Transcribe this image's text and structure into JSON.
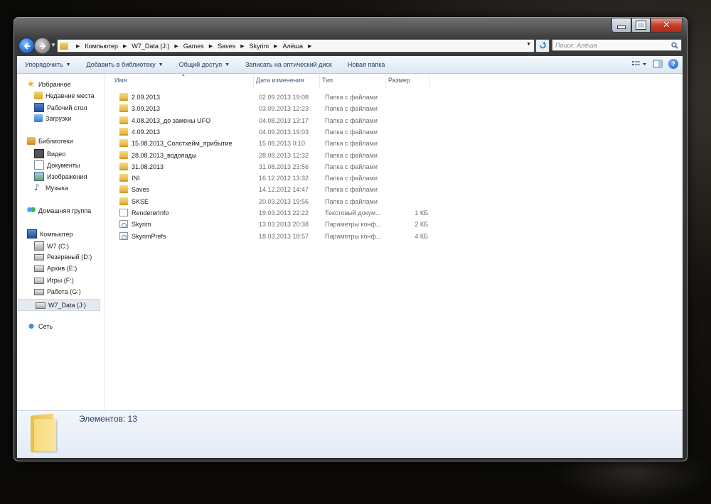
{
  "window": {
    "address": [
      "Компьютер",
      "W7_Data (J:)",
      "Games",
      "Saves",
      "Skyrim",
      "Алёша"
    ],
    "search_placeholder": "Поиск: Алёша"
  },
  "toolbar": {
    "organize": "Упорядочить",
    "add_to_library": "Добавить в библиотеку",
    "share": "Общий доступ",
    "burn": "Записать на оптический диск",
    "new_folder": "Новая папка"
  },
  "navigation": {
    "favorites": {
      "label": "Избранное",
      "items": [
        "Недавние места",
        "Рабочий стол",
        "Загрузки"
      ]
    },
    "libraries": {
      "label": "Библиотеки",
      "items": [
        "Видео",
        "Документы",
        "Изображения",
        "Музыка"
      ]
    },
    "homegroup": {
      "label": "Домашняя группа"
    },
    "computer": {
      "label": "Компьютер",
      "items": [
        "W7 (C:)",
        "Резервный (D:)",
        "Архив (E:)",
        "Игры (F:)",
        "Работа (G:)",
        "W7_Data (J:)"
      ],
      "selected": "W7_Data (J:)"
    },
    "network": {
      "label": "Сеть"
    }
  },
  "columns": {
    "name": "Имя",
    "date": "Дата изменения",
    "type": "Тип",
    "size": "Размер"
  },
  "files": [
    {
      "icon": "folder-icon",
      "name": "2.09.2013",
      "date": "02.09.2013 19:08",
      "type": "Папка с файлами",
      "size": ""
    },
    {
      "icon": "folder-icon",
      "name": "3.09.2013",
      "date": "03.09.2013 12:23",
      "type": "Папка с файлами",
      "size": ""
    },
    {
      "icon": "folder-icon",
      "name": "4.08.2013_до замены UFO",
      "date": "04.08.2013 13:17",
      "type": "Папка с файлами",
      "size": ""
    },
    {
      "icon": "folder-icon",
      "name": "4.09.2013",
      "date": "04.09.2013 19:03",
      "type": "Папка с файлами",
      "size": ""
    },
    {
      "icon": "folder-icon",
      "name": "15.08.2013_Солстхейм_прибытие",
      "date": "15.08.2013 0:10",
      "type": "Папка с файлами",
      "size": ""
    },
    {
      "icon": "folder-icon",
      "name": "28.08.2013_водопады",
      "date": "28.08.2013 12:32",
      "type": "Папка с файлами",
      "size": ""
    },
    {
      "icon": "folder-icon",
      "name": "31.08.2013",
      "date": "31.08.2013 23:56",
      "type": "Папка с файлами",
      "size": ""
    },
    {
      "icon": "folder-icon",
      "name": "INI",
      "date": "16.12.2012 13:32",
      "type": "Папка с файлами",
      "size": ""
    },
    {
      "icon": "folder-icon",
      "name": "Saves",
      "date": "14.12.2012 14:47",
      "type": "Папка с файлами",
      "size": ""
    },
    {
      "icon": "folder-icon",
      "name": "SKSE",
      "date": "20.03.2013 19:56",
      "type": "Папка с файлами",
      "size": ""
    },
    {
      "icon": "text-file-icon",
      "name": "RendererInfo",
      "date": "19.03.2013 22:22",
      "type": "Текстовый докум...",
      "size": "1 КБ"
    },
    {
      "icon": "config-file-icon",
      "name": "Skyrim",
      "date": "13.03.2013 20:38",
      "type": "Параметры конф...",
      "size": "2 КБ"
    },
    {
      "icon": "config-file-icon",
      "name": "SkyrimPrefs",
      "date": "18.03.2013 18:57",
      "type": "Параметры конф...",
      "size": "4 КБ"
    }
  ],
  "status": {
    "count_text": "Элементов: 13"
  },
  "colors": {
    "title_gradient_top": "#6f6f6f",
    "close_red": "#c4402a",
    "command_text": "#1e395b",
    "folder_yellow": "#f6d56e"
  }
}
